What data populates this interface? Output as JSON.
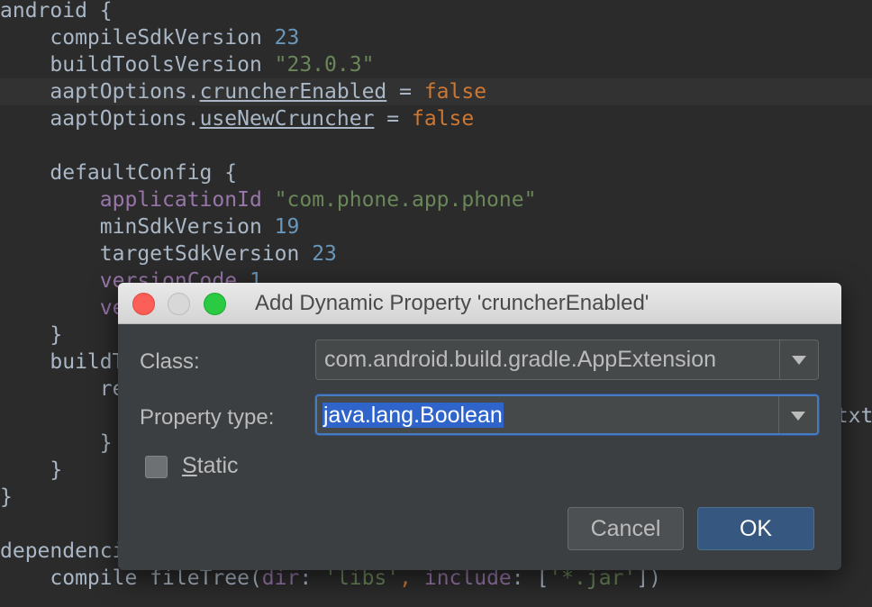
{
  "editor": {
    "lines": [
      {
        "segments": [
          {
            "t": "android {",
            "c": "k"
          }
        ]
      },
      {
        "segments": [
          {
            "t": "    compileSdkVersion ",
            "c": "k"
          },
          {
            "t": "23",
            "c": "num"
          }
        ]
      },
      {
        "segments": [
          {
            "t": "    buildToolsVersion ",
            "c": "k"
          },
          {
            "t": "\"23.0.3\"",
            "c": "str"
          }
        ]
      },
      {
        "segments": [
          {
            "t": "    aaptOptions.",
            "c": "k"
          },
          {
            "t": "cruncherEnabled",
            "c": "ul"
          },
          {
            "t": " = ",
            "c": "k"
          },
          {
            "t": "false",
            "c": "kw"
          }
        ]
      },
      {
        "segments": [
          {
            "t": "    aaptOptions.",
            "c": "k"
          },
          {
            "t": "useNewCruncher",
            "c": "ul"
          },
          {
            "t": " = ",
            "c": "k"
          },
          {
            "t": "false",
            "c": "kw"
          }
        ]
      },
      {
        "segments": []
      },
      {
        "segments": [
          {
            "t": "    defaultConfig {",
            "c": "k"
          }
        ]
      },
      {
        "segments": [
          {
            "t": "        ",
            "c": "k"
          },
          {
            "t": "applicationId",
            "c": "prop"
          },
          {
            "t": " ",
            "c": "k"
          },
          {
            "t": "\"com.phone.app.phone\"",
            "c": "str"
          }
        ]
      },
      {
        "segments": [
          {
            "t": "        minSdkVersion ",
            "c": "k"
          },
          {
            "t": "19",
            "c": "num"
          }
        ]
      },
      {
        "segments": [
          {
            "t": "        targetSdkVersion ",
            "c": "k"
          },
          {
            "t": "23",
            "c": "num"
          }
        ]
      },
      {
        "segments": [
          {
            "t": "        ",
            "c": "k"
          },
          {
            "t": "versionCode",
            "c": "prop"
          },
          {
            "t": " ",
            "c": "k"
          },
          {
            "t": "1",
            "c": "num"
          }
        ]
      },
      {
        "segments": [
          {
            "t": "        ve",
            "c": "prop"
          }
        ]
      },
      {
        "segments": [
          {
            "t": "    }",
            "c": "k"
          }
        ]
      },
      {
        "segments": [
          {
            "t": "    buildT",
            "c": "k"
          }
        ]
      },
      {
        "segments": [
          {
            "t": "        re",
            "c": "k"
          }
        ]
      },
      {
        "segments": [
          {
            "t": "                                                                   txt",
            "c": "k"
          }
        ]
      },
      {
        "segments": [
          {
            "t": "        }",
            "c": "k"
          }
        ]
      },
      {
        "segments": [
          {
            "t": "    }",
            "c": "k"
          }
        ]
      },
      {
        "segments": [
          {
            "t": "}",
            "c": "k"
          }
        ]
      },
      {
        "segments": []
      },
      {
        "segments": [
          {
            "t": "dependencies {",
            "c": "k"
          }
        ]
      },
      {
        "segments": [
          {
            "t": "    compile fileTree(",
            "c": "k"
          },
          {
            "t": "dir",
            "c": "prop"
          },
          {
            "t": ": ",
            "c": "k"
          },
          {
            "t": "'libs'",
            "c": "str"
          },
          {
            "t": ", ",
            "c": "kw"
          },
          {
            "t": "include",
            "c": "prop"
          },
          {
            "t": ": [",
            "c": "k"
          },
          {
            "t": "'*.jar'",
            "c": "str"
          },
          {
            "t": "])",
            "c": "k"
          }
        ]
      }
    ]
  },
  "dialog": {
    "title": "Add Dynamic Property 'cruncherEnabled'",
    "class_label": "Class:",
    "class_value": "com.android.build.gradle.AppExtension",
    "type_label": "Property type:",
    "type_value": "java.lang.Boolean",
    "static_label_first": "S",
    "static_label_rest": "tatic",
    "static_checked": false,
    "cancel_label": "Cancel",
    "ok_label": "OK"
  }
}
